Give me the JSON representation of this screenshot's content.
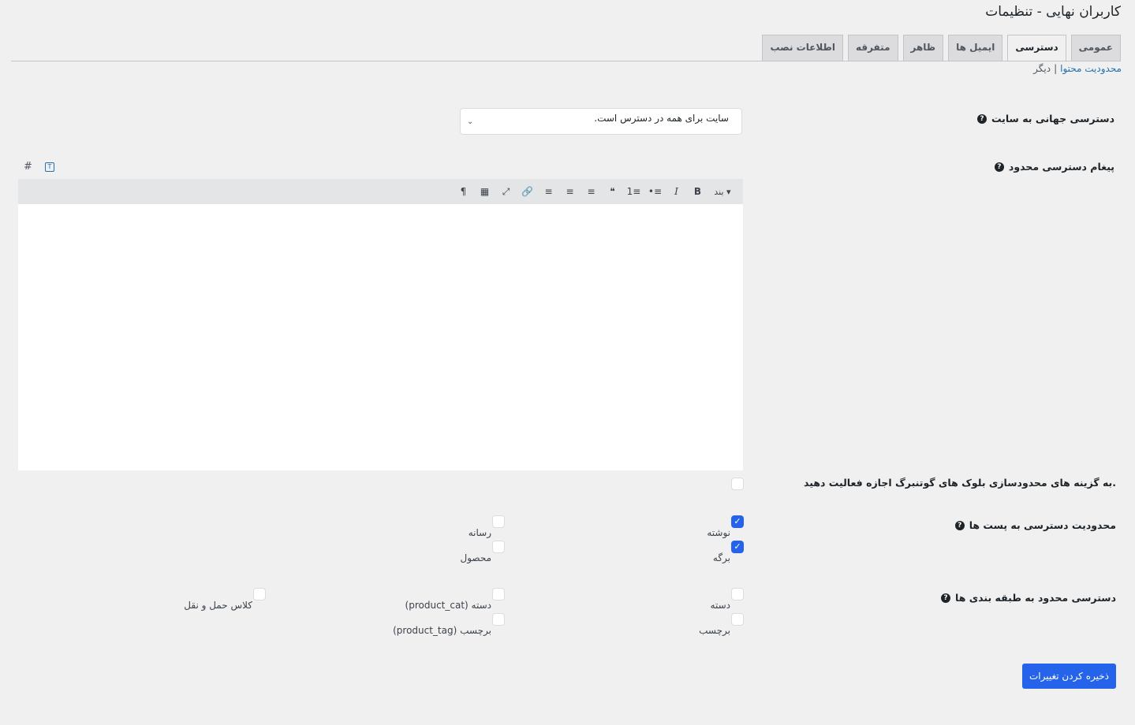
{
  "page": {
    "title": "کاربران نهایی - تنظیمات"
  },
  "tabs": [
    {
      "label": "عمومی",
      "active": false
    },
    {
      "label": "دسترسی",
      "active": true
    },
    {
      "label": "ایمیل ها",
      "active": false
    },
    {
      "label": "ظاهر",
      "active": false
    },
    {
      "label": "متفرقه",
      "active": false
    },
    {
      "label": "اطلاعات نصب",
      "active": false
    }
  ],
  "subnav": {
    "content_restriction": "محدودیت محتوا",
    "separator": "|",
    "other": "دیگر"
  },
  "global_access": {
    "label": "دسترسی جهانی به سایت",
    "value": "سایت برای همه در دسترس است."
  },
  "restricted_message": {
    "label": "پیغام دسترسی محدود",
    "editor_tabs": {
      "visual": "T",
      "code": "#"
    },
    "toolbar": {
      "format": "بند",
      "buttons": [
        "B",
        "I",
        "•≡",
        "1≡",
        "❝",
        "≡",
        "≡",
        "≡",
        "🔗",
        "⤢",
        "▦",
        "¶"
      ]
    },
    "content": ""
  },
  "gutenberg": {
    "label": "به گزینه های محدودسازی بلوک های گوتنبرگ اجازه فعالیت دهید.",
    "checked": false
  },
  "post_types": {
    "label": "محدودیت دسترسی به پست ها",
    "items": [
      {
        "label": "نوشته",
        "checked": true
      },
      {
        "label": "رسانه",
        "checked": false
      },
      {
        "label": "برگه",
        "checked": true
      },
      {
        "label": "محصول",
        "checked": false
      }
    ]
  },
  "taxonomies": {
    "label": "دسترسی محدود به طبقه بندی ها",
    "items": [
      {
        "label": "دسته",
        "checked": false
      },
      {
        "label": "دسته (product_cat)",
        "checked": false
      },
      {
        "label": "کلاس حمل و نقل",
        "checked": false
      },
      {
        "label": "برچسب",
        "checked": false
      },
      {
        "label": "برچسب (product_tag)",
        "checked": false
      }
    ]
  },
  "save_button": "ذخیره کردن تغییرات",
  "colors": {
    "accent": "#2563eb",
    "link": "#2271b1",
    "background": "#f0f0f1"
  }
}
